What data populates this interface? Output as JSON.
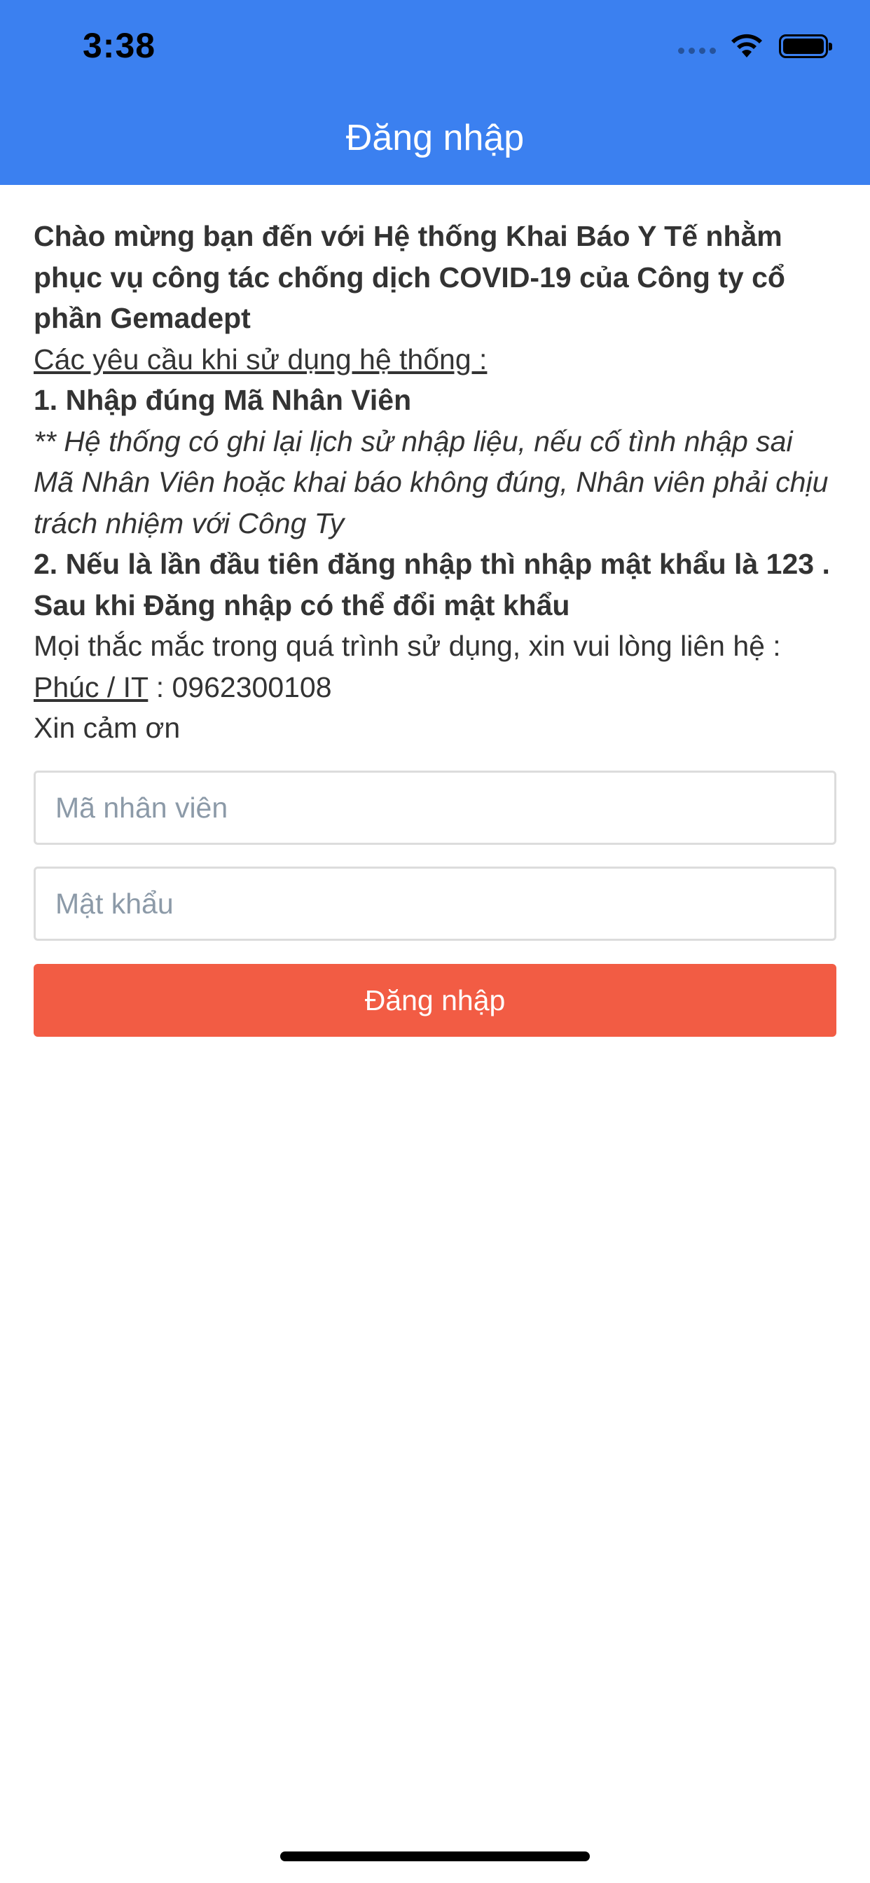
{
  "status_bar": {
    "time": "3:38",
    "icons": [
      "signal-dots-icon",
      "wifi-icon",
      "battery-icon"
    ]
  },
  "nav": {
    "title": "Đăng nhập"
  },
  "intro": {
    "welcome": "Chào mừng bạn đến với Hệ thống Khai Báo Y Tế nhằm phục vụ công tác chống dịch COVID-19 của Công ty cổ phần Gemadept",
    "requirements_heading": "Các yêu cầu khi sử dụng hệ thống :",
    "rule1": "1. Nhập đúng Mã Nhân Viên",
    "rule1_note": "** Hệ thống có ghi lại lịch sử nhập liệu, nếu cố tình nhập sai Mã Nhân Viên hoặc khai báo không đúng, Nhân viên phải chịu trách nhiệm với Công Ty",
    "rule2": "2. Nếu là lần đầu tiên đăng nhập thì nhập mật khẩu là 123 . Sau khi Đăng nhập có thể đổi mật khẩu",
    "contact_text": "Mọi thắc mắc trong quá trình sử dụng, xin vui lòng liên hệ :",
    "contact_name": "Phúc / IT",
    "contact_phone": " : 0962300108",
    "thanks": "Xin cảm ơn"
  },
  "form": {
    "employee_id_placeholder": "Mã nhân viên",
    "employee_id_value": "",
    "password_placeholder": "Mật khẩu",
    "password_value": "",
    "submit_label": "Đăng nhập"
  },
  "colors": {
    "header_bg": "#3b80f0",
    "button_bg": "#f25c44",
    "placeholder": "#8c9aa8",
    "text": "#333333"
  }
}
